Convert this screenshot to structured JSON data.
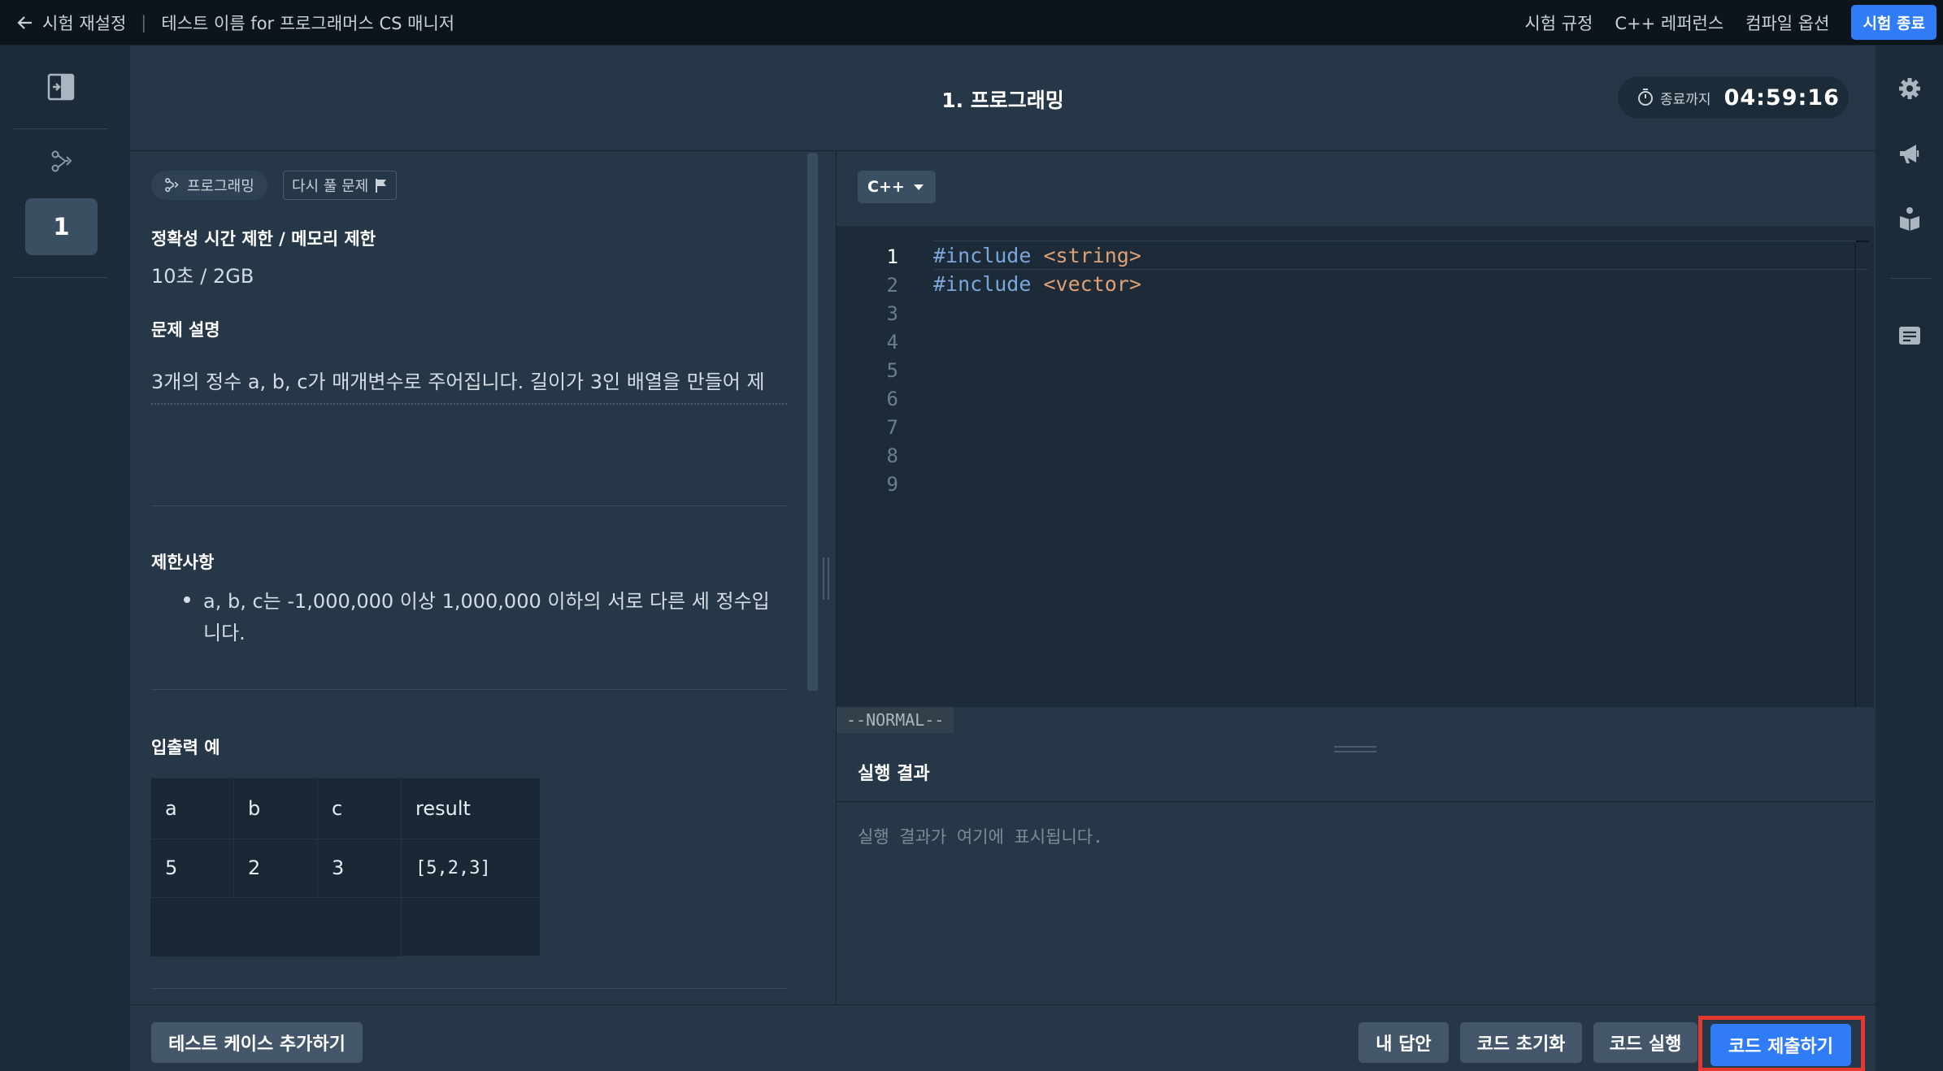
{
  "topbar": {
    "back_label": "시험 재설정",
    "test_name": "테스트 이름 for 프로그래머스 CS 매니저",
    "links": [
      "시험 규정",
      "C++ 레퍼런스",
      "컴파일 옵션"
    ],
    "end_label": "시험 종료"
  },
  "rail": {
    "question_number": "1"
  },
  "header": {
    "title": "1. 프로그래밍",
    "timer_label": "종료까지",
    "timer_value": "04:59:16"
  },
  "problem": {
    "type_chip": "프로그래밍",
    "retry_chip": "다시 풀 문제",
    "limits_heading": "정확성 시간 제한 / 메모리 제한",
    "limits_value": "10초 / 2GB",
    "desc_heading": "문제 설명",
    "desc_line1": "3개의 정수 a, b, c가 매개변수로 주어집니다. 길이가 3인 배열을 만들어 제",
    "constraints_heading": "제한사항",
    "constraint_line1": "a, b, c는 -1,000,000 이상 1,000,000 이하의 서로 다른 세 정수입",
    "constraint_line2": "니다.",
    "io_heading": "입출력 예",
    "io_table": {
      "headers": [
        "a",
        "b",
        "c",
        "result"
      ],
      "rows": [
        [
          "5",
          "2",
          "3",
          "[5,2,3]"
        ]
      ]
    }
  },
  "editor": {
    "language": "C++",
    "line_numbers": [
      "1",
      "2",
      "3",
      "4",
      "5",
      "6",
      "7",
      "8",
      "9"
    ],
    "lines": [
      {
        "kw": "#include",
        "str": "<string>"
      },
      {
        "kw": "#include",
        "str": "<vector>"
      }
    ],
    "mode": "--NORMAL--"
  },
  "results": {
    "title": "실행 결과",
    "placeholder": "실행 결과가 여기에 표시됩니다."
  },
  "footer": {
    "add_testcase": "테스트 케이스 추가하기",
    "my_answer": "내 답안",
    "reset_code": "코드 초기화",
    "run_code": "코드 실행",
    "submit_code": "코드 제출하기"
  }
}
